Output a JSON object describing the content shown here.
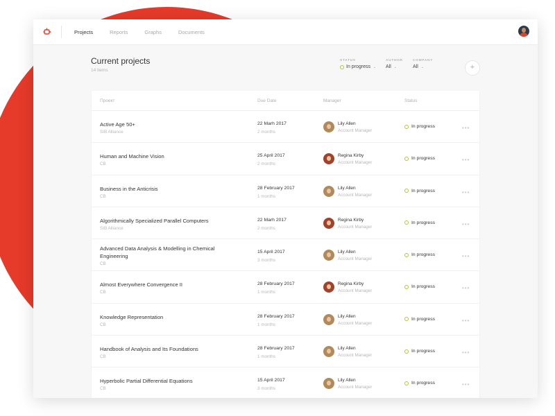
{
  "nav": {
    "items": [
      {
        "label": "Projects",
        "active": true
      },
      {
        "label": "Reports",
        "active": false
      },
      {
        "label": "Graphs",
        "active": false
      },
      {
        "label": "Documents",
        "active": false
      }
    ]
  },
  "header": {
    "title": "Current projects",
    "count": "14 items",
    "filters": {
      "status": {
        "label": "STATUS",
        "value": "In progress"
      },
      "author": {
        "label": "AUTHOR",
        "value": "All"
      },
      "company": {
        "label": "COMPANY",
        "value": "All"
      }
    },
    "add_label": "+"
  },
  "table": {
    "columns": {
      "project": "Проект",
      "due_date": "Due Date",
      "manager": "Manager",
      "status": "Status"
    },
    "rows": [
      {
        "title": "Active Age 50+",
        "company": "SIB Alliance",
        "date": "22 Marh 2017",
        "duration": "2 months",
        "manager": "Lily Allen",
        "role": "Account Manager",
        "status": "In progress",
        "more": "•••"
      },
      {
        "title": "Human and Machine Vision",
        "company": "CB",
        "date": "25 April 2017",
        "duration": "2 months",
        "manager": "Regina Kirby",
        "role": "Account Manager",
        "status": "In progress",
        "more": "•••"
      },
      {
        "title": "Business in the Anticrisis",
        "company": "CB",
        "date": "28 February 2017",
        "duration": "1 months",
        "manager": "Lily Allen",
        "role": "Account Manager",
        "status": "In progress",
        "more": "•••"
      },
      {
        "title": "Algorithmically Specialized Parallel Computers",
        "company": "SIB Alliance",
        "date": "22 Marh 2017",
        "duration": "2 months",
        "manager": "Regina Kirby",
        "role": "Account Manager",
        "status": "In progress",
        "more": "•••"
      },
      {
        "title": "Advanced Data Analysis & Modelling in Chemical Engineering",
        "company": "CB",
        "date": "15 April 2017",
        "duration": "3 months",
        "manager": "Lily Allen",
        "role": "Account Manager",
        "status": "In progress",
        "more": "•••"
      },
      {
        "title": "Almost Everywhere Convergence II",
        "company": "CB",
        "date": "28 February 2017",
        "duration": "1 months",
        "manager": "Regina Kirby",
        "role": "Account Manager",
        "status": "In progress",
        "more": "•••"
      },
      {
        "title": "Knowledge Representation",
        "company": "CB",
        "date": "28 February 2017",
        "duration": "1 months",
        "manager": "Lily Allen",
        "role": "Account Manager",
        "status": "In progress",
        "more": "•••"
      },
      {
        "title": "Handbook of Analysis and Its Foundations",
        "company": "CB",
        "date": "28 February 2017",
        "duration": "1 months",
        "manager": "Lily Allen",
        "role": "Account Manager",
        "status": "In progress",
        "more": "•••"
      },
      {
        "title": "Hyperbolic Partial Differential Equations",
        "company": "CB",
        "date": "15 April 2017",
        "duration": "3 months",
        "manager": "Lily Allen",
        "role": "Account Manager",
        "status": "In progress",
        "more": "•••"
      }
    ]
  },
  "colors": {
    "accent_red": "#e63a2a",
    "status_dot": "#b7c23a",
    "lily_avatar": "#b08a5a",
    "regina_avatar": "#a0432a"
  },
  "icons": {
    "logo": "logo-mark-icon",
    "add": "plus-icon",
    "more": "more-dots-icon",
    "user": "user-avatar"
  }
}
